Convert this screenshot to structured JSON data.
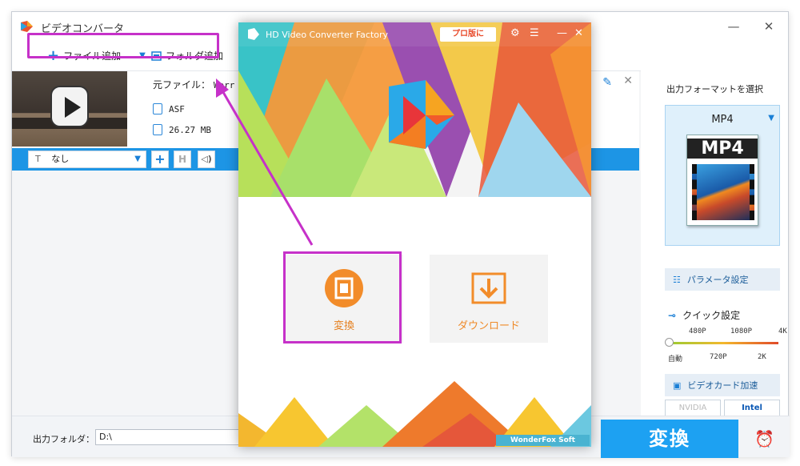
{
  "main_window": {
    "title": "ビデオコンバータ",
    "controls": {
      "minimize": "—",
      "maximize": "☐",
      "close": "✕"
    }
  },
  "toolbar": {
    "add_file_label": "ファイル追加",
    "add_folder_label": "フォルダ追加"
  },
  "file_item": {
    "source_label": "元ファイル：",
    "source_name": "Worr",
    "format": "ASF",
    "size": "26.27 MB",
    "subtitle_value": "なし",
    "subtitle_prefix": "T",
    "add_label": "+",
    "h_label": "H",
    "audio_icon": "speaker-icon",
    "close_icon": "✕",
    "edit_icon": "✎"
  },
  "bottom": {
    "output_folder_label": "出力フォルダ：",
    "output_path": "D:\\",
    "convert_label": "変換",
    "alarm_icon": "⏰"
  },
  "right_panel": {
    "select_format_label": "出力フォーマットを選択",
    "format_name": "MP4",
    "format_badge": "MP4",
    "param_settings_label": "パラメータ設定",
    "quick_settings_label": "クイック設定",
    "quick_dash": "⊸",
    "ticks_top": [
      "480P",
      "1080P",
      "4K"
    ],
    "ticks_bottom": [
      "自動",
      "720P",
      "2K"
    ],
    "gpu_accel_label": "ビデオカード加速",
    "nvidia_label": "NVIDIA",
    "intel_label": "Intel"
  },
  "popup": {
    "title": "HD Video Converter Factory",
    "pro_button": "プロ版に",
    "cards": {
      "convert_label": "変換",
      "download_label": "ダウンロード"
    },
    "brand_badge": "WonderFox Soft",
    "controls": {
      "settings": "⚙",
      "menu": "☰",
      "minimize": "—",
      "close": "✕"
    }
  },
  "colors": {
    "accent_blue": "#1da1f2",
    "highlight_magenta": "#c631c9",
    "orange": "#f28c2a"
  }
}
